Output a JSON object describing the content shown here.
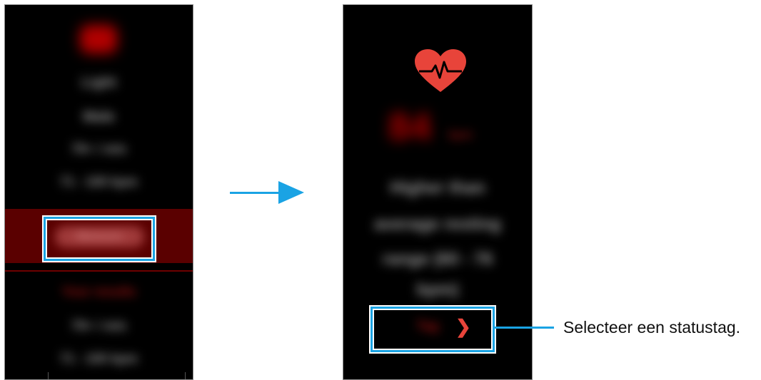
{
  "left_screen": {
    "header_value": "—",
    "rows": [
      "Light",
      "Male",
      "79+ / min",
      "71 - 100 bpm"
    ],
    "highlight_button_label": "Measure",
    "status_label": "Your results",
    "history_rows": [
      "79+ / min",
      "71 - 100 bpm"
    ]
  },
  "right_screen": {
    "heart_rate_value": "84",
    "heart_rate_unit": "bpm",
    "status_lines": [
      "Higher than",
      "average resting",
      "range (60 - 76",
      "bpm)"
    ],
    "tag_button_label": "Tag",
    "tag_button_chevron": "❯"
  },
  "callout": {
    "text": "Selecteer een statustag."
  },
  "colors": {
    "accent_blue": "#1aa3e4",
    "heart_red": "#e8443a"
  }
}
